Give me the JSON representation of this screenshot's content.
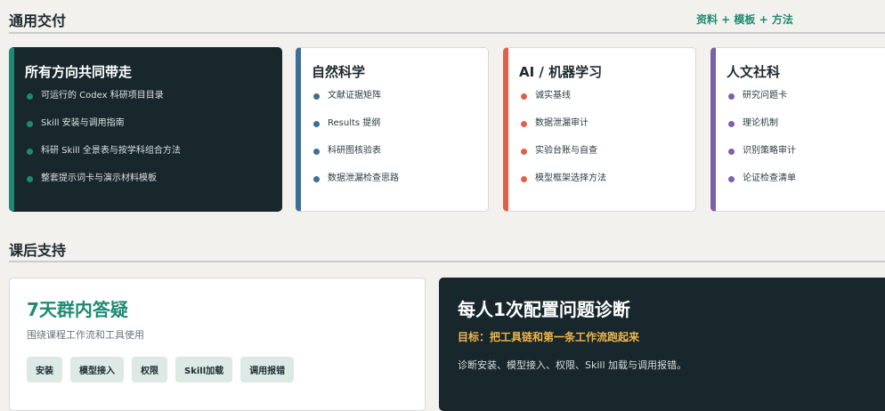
{
  "delivery": {
    "title": "通用交付",
    "tag": "资料 + 模板 + 方法",
    "cards": [
      {
        "title": "所有方向共同带走",
        "items": [
          "可运行的 Codex 科研项目目录",
          "Skill 安装与调用指南",
          "科研 Skill 全景表与按学科组合方法",
          "整套提示词卡与演示材料模板"
        ],
        "accent": "#1e8a72"
      },
      {
        "title": "自然科学",
        "items": [
          "文献证据矩阵",
          "Results 提纲",
          "科研图核验表",
          "数据泄漏检查思路"
        ],
        "accent": "#3b6f96"
      },
      {
        "title": "AI / 机器学习",
        "items": [
          "诚实基线",
          "数据泄漏审计",
          "实验台账与自查",
          "模型框架选择方法"
        ],
        "accent": "#e0604a"
      },
      {
        "title": "人文社科",
        "items": [
          "研究问题卡",
          "理论机制",
          "识别策略审计",
          "论证检查清单"
        ],
        "accent": "#7a62a8"
      }
    ]
  },
  "support": {
    "title": "课后支持",
    "qa": {
      "title": "7天群内答疑",
      "subtitle": "围绕课程工作流和工具使用",
      "chips": [
        "安装",
        "模型接入",
        "权限",
        "Skill加载",
        "调用报错"
      ]
    },
    "diagnosis": {
      "title": "每人1次配置问题诊断",
      "goal": "目标：把工具链和第一条工作流跑起来",
      "description": "诊断安装、模型接入、权限、Skill 加载与调用报错。"
    }
  }
}
